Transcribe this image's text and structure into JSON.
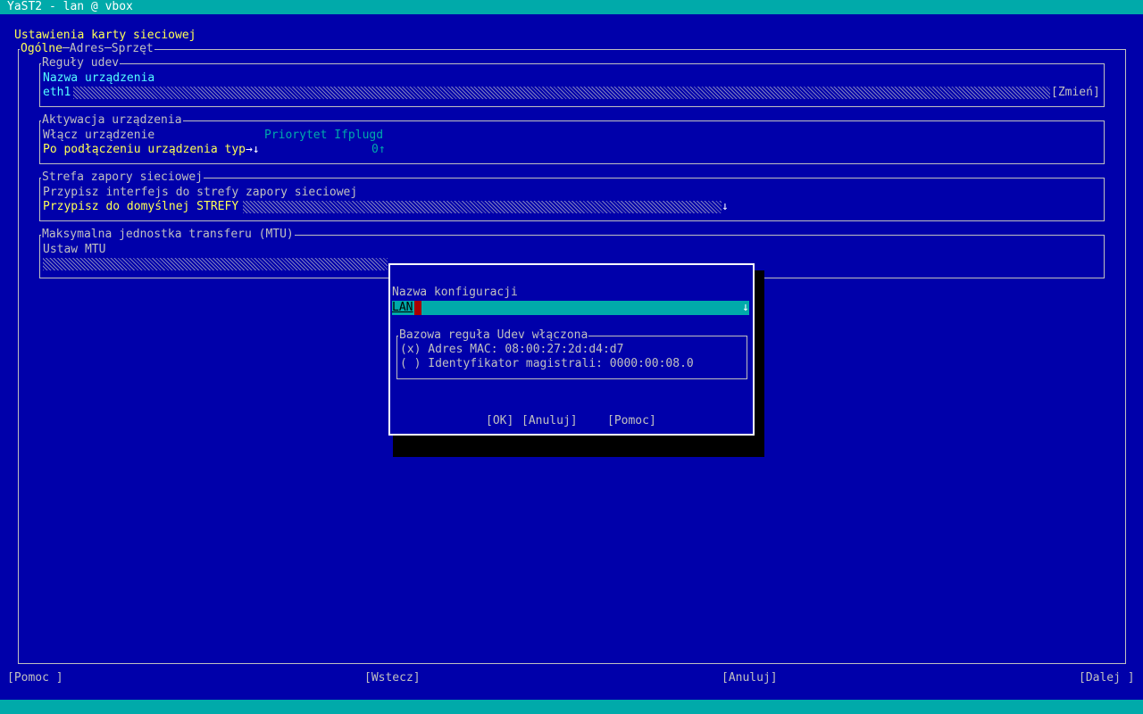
{
  "window": {
    "title": "YaST2 - lan @ vbox"
  },
  "page": {
    "title": "Ustawienia karty sieciowej"
  },
  "tabs": [
    "Ogólne",
    "Adres",
    "Sprzęt"
  ],
  "udev": {
    "legend": "Reguły udev",
    "device_name_label": "Nazwa urządzenia",
    "device_name_value": "eth1",
    "change_button": "[Zmień]"
  },
  "activation": {
    "legend": "Aktywacja urządzenia",
    "enable_label": "Włącz urządzenie",
    "enable_value": "Po podłączeniu urządzenia typ",
    "enable_arrow": "→↓",
    "priority_label": "Priorytet Ifplugd",
    "priority_value": "0",
    "priority_arrow": "↑"
  },
  "firewall": {
    "legend": "Strefa zapory sieciowej",
    "assign_label": "Przypisz interfejs do strefy zapory sieciowej",
    "assign_value": "Przypisz do domyślnej STREFY",
    "assign_arrow": "↓"
  },
  "mtu": {
    "legend": "Maksymalna jednostka transferu (MTU)",
    "set_label": "Ustaw MTU"
  },
  "dialog": {
    "config_name_label": "Nazwa konfiguracji",
    "config_name_value": "LAN",
    "config_arrow": "↓",
    "udev_group_legend": "Bazowa reguła Udev włączona",
    "option_mac": "(x) Adres MAC: 08:00:27:2d:d4:d7",
    "option_bus": "( ) Identyfikator magistrali: 0000:00:08.0",
    "ok_button": "[OK]",
    "cancel_button": "[Anuluj]",
    "help_button": "[Pomoc]"
  },
  "footer": {
    "help_button": "[Pomoc ]",
    "back_button": "[Wstecz]",
    "cancel_button": "[Anuluj]",
    "next_button": "[Dalej ]"
  },
  "colors": {
    "background": "#0000aa",
    "bar": "#00aaaa",
    "highlight": "#ffff55",
    "label": "#55ffff"
  }
}
